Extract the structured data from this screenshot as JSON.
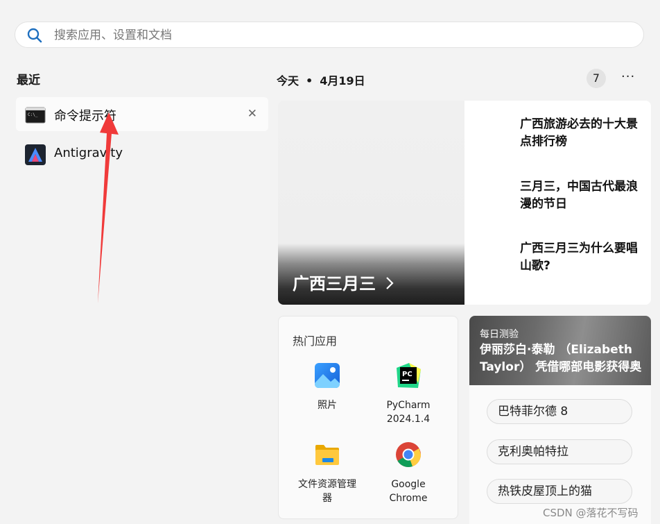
{
  "search": {
    "placeholder": "搜索应用、设置和文档"
  },
  "recent": {
    "title": "最近",
    "items": [
      {
        "label": "命令提示符",
        "icon": "command-prompt-icon"
      },
      {
        "label": "Antigravity",
        "icon": "antigravity-icon"
      }
    ]
  },
  "today": {
    "label": "今天",
    "date": "4月19日",
    "badge": "7",
    "more": "···"
  },
  "hero": {
    "title": "广西三月三",
    "stories": [
      "广西旅游必去的十大景点排行榜",
      "三月三，中国古代最浪漫的节日",
      "广西三月三为什么要唱山歌?"
    ]
  },
  "hot_apps": {
    "title": "热门应用",
    "apps": [
      {
        "label": "照片",
        "icon": "photos-icon"
      },
      {
        "label": "PyCharm\n2024.1.4",
        "icon": "pycharm-icon"
      },
      {
        "label": "文件资源管理\n器",
        "icon": "file-explorer-icon"
      },
      {
        "label": "Google\nChrome",
        "icon": "chrome-icon"
      }
    ]
  },
  "quiz": {
    "tag": "每日测验",
    "question": "伊丽莎白·泰勒 （Elizabeth Taylor） 凭借哪部电影获得奥斯卡奖?",
    "options": [
      "巴特菲尔德 8",
      "克利奥帕特拉",
      "热铁皮屋顶上的猫"
    ]
  },
  "watermark": "CSDN @落花不写码",
  "colors": {
    "annotation_arrow": "#f03a3a",
    "background": "#f3f3f3"
  }
}
